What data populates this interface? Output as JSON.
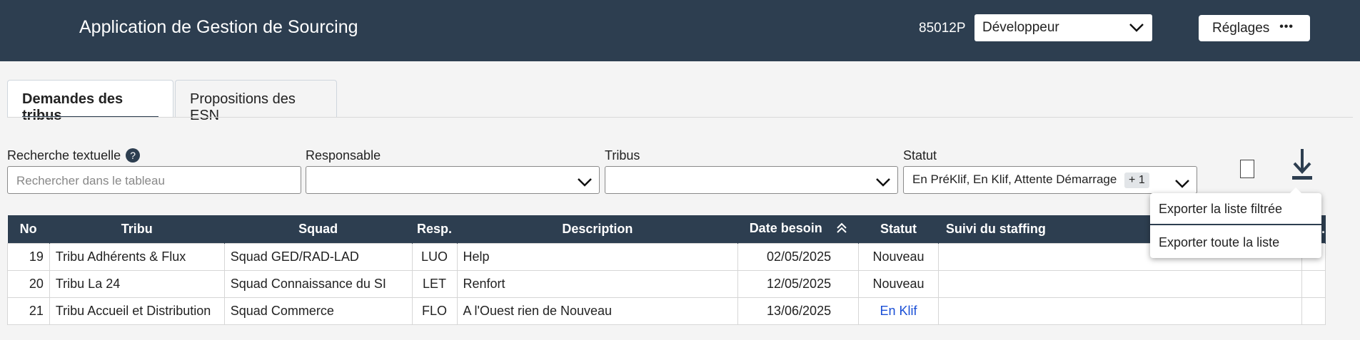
{
  "header": {
    "title": "Application de Gestion de Sourcing",
    "user_code": "85012P",
    "role_value": "Développeur",
    "settings_label": "Réglages",
    "settings_icon": "more-horizontal-icon"
  },
  "tabs": [
    {
      "label": "Demandes des tribus",
      "active": true
    },
    {
      "label": "Propositions des ESN",
      "active": false
    }
  ],
  "filters": {
    "search": {
      "label": "Recherche textuelle",
      "placeholder": "Rechercher dans le tableau",
      "value": ""
    },
    "responsable": {
      "label": "Responsable",
      "value": ""
    },
    "tribus": {
      "label": "Tribus",
      "value": ""
    },
    "statut": {
      "label": "Statut",
      "value": "En PréKlif, En Klif, Attente Démarrage",
      "extra_count": "+ 1"
    }
  },
  "table": {
    "columns": [
      "No",
      "Tribu",
      "Squad",
      "Resp.",
      "Description",
      "Date besoin",
      "Statut",
      "Suivi du staffing",
      "om."
    ],
    "sorted_column": "Date besoin",
    "sort_direction": "ascending",
    "rows": [
      {
        "no": "19",
        "tribu": "Tribu Adhérents & Flux",
        "squad": "Squad GED/RAD-LAD",
        "resp": "LUO",
        "description": "Help",
        "date": "02/05/2025",
        "statut": "Nouveau",
        "suivi": "",
        "com": ""
      },
      {
        "no": "20",
        "tribu": "Tribu La 24",
        "squad": "Squad Connaissance du SI",
        "resp": "LET",
        "description": "Renfort",
        "date": "12/05/2025",
        "statut": "Nouveau",
        "suivi": "",
        "com": ""
      },
      {
        "no": "21",
        "tribu": "Tribu Accueil et Distribution",
        "squad": "Squad Commerce",
        "resp": "FLO",
        "description": "A l'Ouest rien de Nouveau",
        "date": "13/06/2025",
        "statut": "En Klif",
        "suivi": "",
        "com": ""
      }
    ]
  },
  "export_menu": {
    "items": [
      "Exporter la liste filtrée",
      "Exporter toute la liste"
    ]
  },
  "colors": {
    "header_bg": "#2d3e50",
    "link_status": "#1a4fd6"
  }
}
